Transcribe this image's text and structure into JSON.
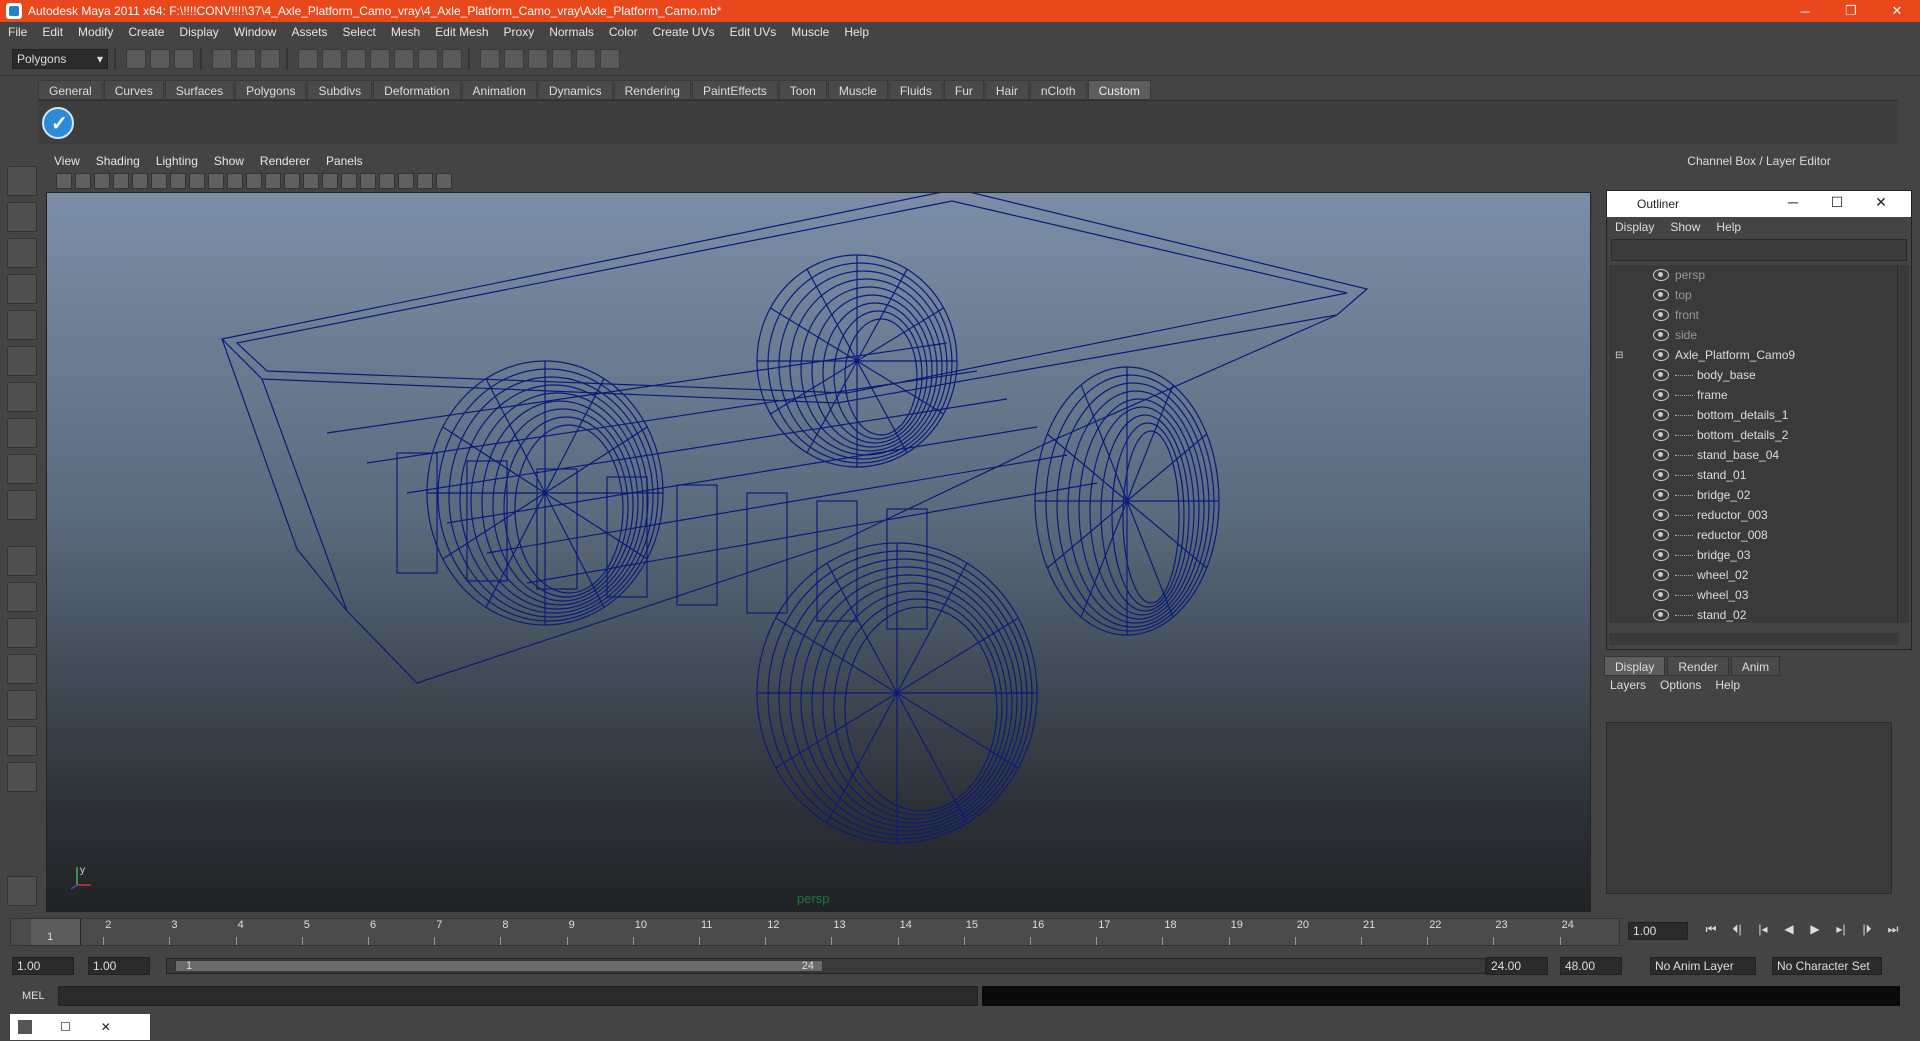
{
  "window": {
    "title": "Autodesk Maya 2011 x64: F:\\!!!!CONV!!!!\\37\\4_Axle_Platform_Camo_vray\\4_Axle_Platform_Camo_vray\\Axle_Platform_Camo.mb*",
    "minimize": "─",
    "maximize": "❐",
    "close": "✕"
  },
  "menubar": [
    "File",
    "Edit",
    "Modify",
    "Create",
    "Display",
    "Window",
    "Assets",
    "Select",
    "Mesh",
    "Edit Mesh",
    "Proxy",
    "Normals",
    "Color",
    "Create UVs",
    "Edit UVs",
    "Muscle",
    "Help"
  ],
  "toolbar": {
    "mode": "Polygons"
  },
  "shelf": {
    "tabs": [
      "General",
      "Curves",
      "Surfaces",
      "Polygons",
      "Subdivs",
      "Deformation",
      "Animation",
      "Dynamics",
      "Rendering",
      "PaintEffects",
      "Toon",
      "Muscle",
      "Fluids",
      "Fur",
      "Hair",
      "nCloth",
      "Custom"
    ],
    "active": "Custom"
  },
  "viewport": {
    "menus": [
      "View",
      "Shading",
      "Lighting",
      "Show",
      "Renderer",
      "Panels"
    ],
    "camera": "persp",
    "axis_y": "y",
    "axis_x": "x",
    "wire_color": "#0b1b7a"
  },
  "channel_box": {
    "title": "Channel Box / Layer Editor"
  },
  "outliner": {
    "title": "Outliner",
    "menus": [
      "Display",
      "Show",
      "Help"
    ],
    "cameras": [
      "persp",
      "top",
      "front",
      "side"
    ],
    "root": "Axle_Platform_Camo9",
    "children": [
      "body_base",
      "frame",
      "bottom_details_1",
      "bottom_details_2",
      "stand_base_04",
      "stand_01",
      "bridge_02",
      "reductor_003",
      "reductor_008",
      "bridge_03",
      "wheel_02",
      "wheel_03",
      "stand_02"
    ]
  },
  "layer_editor": {
    "tabs": [
      "Display",
      "Render",
      "Anim"
    ],
    "active": "Display",
    "menus": [
      "Layers",
      "Options",
      "Help"
    ]
  },
  "timeline": {
    "ticks": [
      "1",
      "2",
      "3",
      "4",
      "5",
      "6",
      "7",
      "8",
      "9",
      "10",
      "11",
      "12",
      "13",
      "14",
      "15",
      "16",
      "17",
      "18",
      "19",
      "20",
      "21",
      "22",
      "23",
      "24"
    ],
    "current_frame": "1",
    "current_field": "1.00"
  },
  "range": {
    "start": "1.00",
    "start2": "1.00",
    "handle_start": "1",
    "handle_end": "24",
    "end": "24.00",
    "end2": "48.00",
    "anim_layer": "No Anim Layer",
    "character_set": "No Character Set"
  },
  "command": {
    "label": "MEL"
  }
}
